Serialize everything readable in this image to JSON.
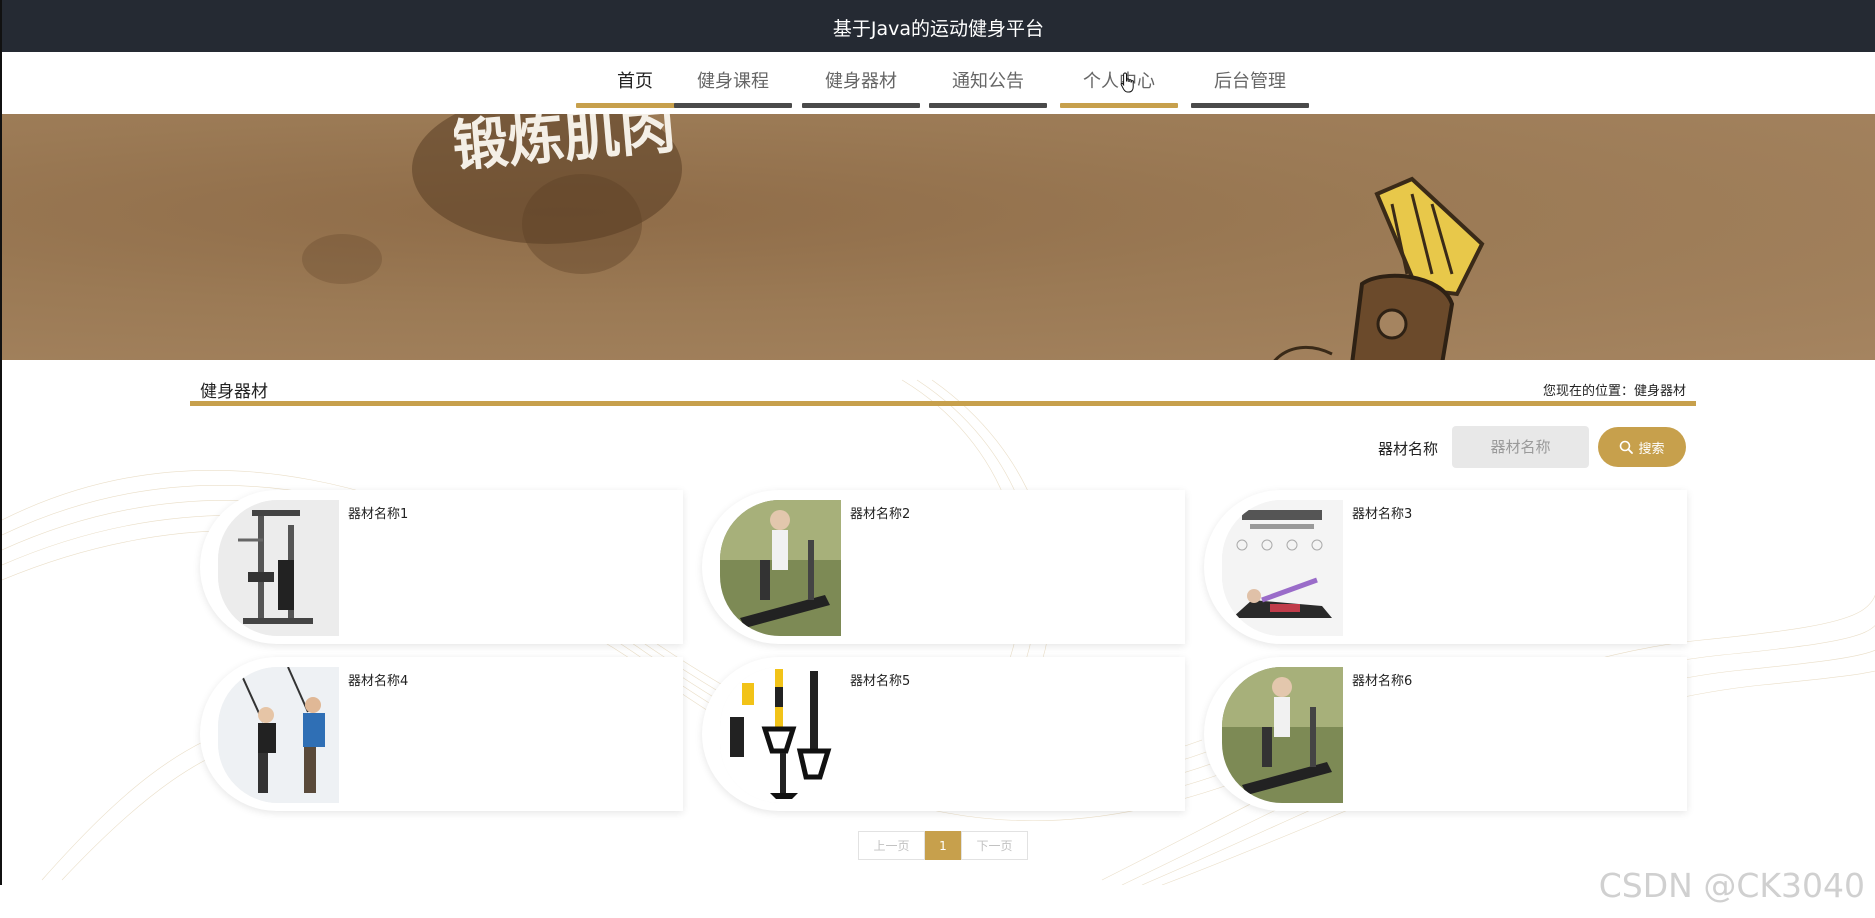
{
  "app": {
    "title": "基于Java的运动健身平台"
  },
  "nav": {
    "items": [
      {
        "label": "首页"
      },
      {
        "label": "健身课程"
      },
      {
        "label": "健身器材"
      },
      {
        "label": "通知公告"
      },
      {
        "label": "个人中心"
      },
      {
        "label": "后台管理"
      }
    ]
  },
  "banner": {
    "text": "锻炼肌肉"
  },
  "section": {
    "title": "健身器材",
    "breadcrumb": "您现在的位置：健身器材"
  },
  "search": {
    "label": "器材名称",
    "placeholder": "器材名称",
    "button_label": "搜索"
  },
  "products": [
    {
      "name": "器材名称1",
      "image_icon": "home-gym-machine-icon"
    },
    {
      "name": "器材名称2",
      "image_icon": "treadmill-icon"
    },
    {
      "name": "器材名称3",
      "image_icon": "resistance-band-icon"
    },
    {
      "name": "器材名称4",
      "image_icon": "suspension-trainer-people-icon"
    },
    {
      "name": "器材名称5",
      "image_icon": "suspension-straps-icon"
    },
    {
      "name": "器材名称6",
      "image_icon": "treadmill-icon"
    }
  ],
  "pagination": {
    "prev": "上一页",
    "current": "1",
    "next": "下一页"
  },
  "watermark": "CSDN @CK3040",
  "colors": {
    "accent": "#c7a04c",
    "header_bg": "#252a33",
    "banner_brown": "#9b7a55",
    "nav_bar_dark": "#4a4a4a"
  }
}
